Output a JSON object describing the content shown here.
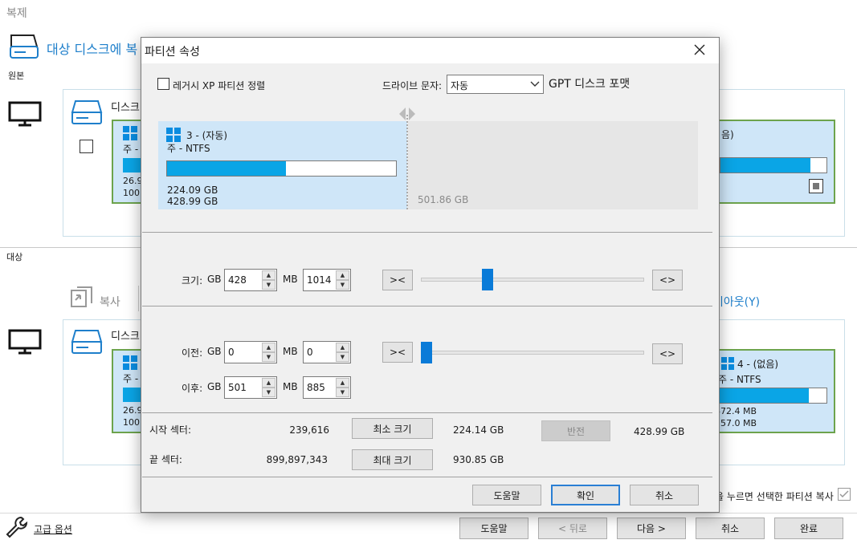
{
  "app": {
    "title": "복제",
    "step_title": "대상 디스크에 복",
    "source_label": "원본",
    "target_label": "대상",
    "source_disk_label": "디스크",
    "target_disk_label": "디스크",
    "src_part_left": {
      "type": "주 - ",
      "size1": "26.9",
      "size2": "100."
    },
    "src_part_right": {
      "name": "음)"
    },
    "tgt_part_left": {
      "type": "주 - ",
      "size1": "26.9",
      "size2": "100."
    },
    "tgt_part_right": {
      "name": "4 - (없음)",
      "type": "주 - NTFS",
      "size1": "472.4 MB",
      "size2": "557.0 MB"
    },
    "copy_label": "복사",
    "layout_label": "이아웃(Y)",
    "copy_hint": "을 누르면 선택한 파티션 복사",
    "advanced_label": "고급 옵션",
    "buttons": {
      "help": "도움말",
      "back": "< 뒤로",
      "next": "다음 >",
      "cancel": "취소",
      "finish": "완료"
    }
  },
  "dialog": {
    "title": "파티션 속성",
    "legacy_align_label": "레거시 XP 파티션 정렬",
    "drive_letter_label": "드라이브 문자:",
    "drive_letter_value": "자동",
    "gpt_label": "GPT 디스크 포맷",
    "partition": {
      "name": "3 -  (자동)",
      "type": "주 - NTFS",
      "used": "224.09 GB",
      "total": "428.99 GB",
      "used_fraction": 0.52
    },
    "free_space": "501.86 GB",
    "size": {
      "label": "크기:",
      "gb_unit": "GB",
      "gb_value": "428",
      "mb_unit": "MB",
      "mb_value": "1014",
      "slider_fraction": 0.3
    },
    "before": {
      "label": "이전:",
      "gb_unit": "GB",
      "gb_value": "0",
      "mb_unit": "MB",
      "mb_value": "0",
      "slider_fraction": 0.0
    },
    "after": {
      "label": "이후:",
      "gb_unit": "GB",
      "gb_value": "501",
      "mb_unit": "MB",
      "mb_value": "885"
    },
    "shrink_btn": "><",
    "expand_btn": "<>",
    "start_sector_label": "시작 섹터:",
    "start_sector_value": "239,616",
    "min_size_btn": "최소 크기",
    "min_size_value": "224.14 GB",
    "reverse_btn": "반전",
    "reverse_value": "428.99 GB",
    "end_sector_label": "끝 섹터:",
    "end_sector_value": "899,897,343",
    "max_size_btn": "최대 크기",
    "max_size_value": "930.85 GB",
    "help_btn": "도움말",
    "ok_btn": "확인",
    "cancel_btn": "취소",
    "colors": {
      "accent": "#0aa5e6",
      "selected_bg": "#cfe6f8",
      "partition_border": "#6da34d"
    }
  }
}
